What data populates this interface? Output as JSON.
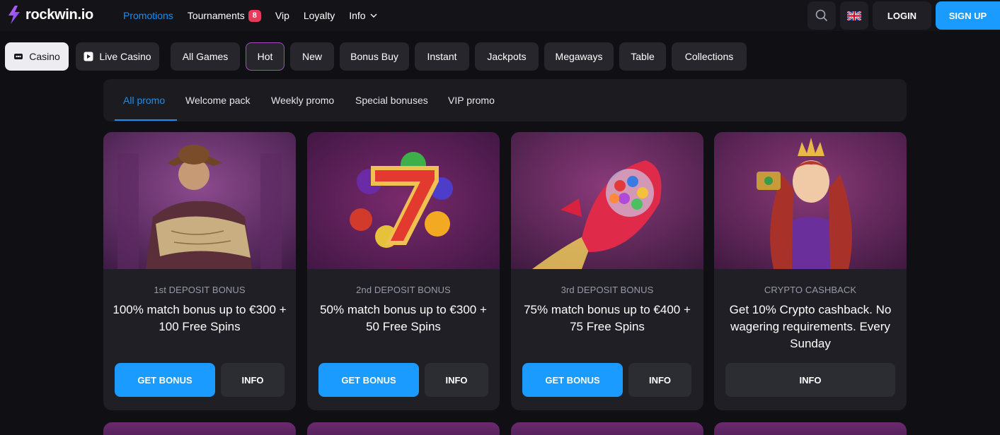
{
  "header": {
    "logo_text": "rockwin.io",
    "nav": [
      {
        "label": "Promotions",
        "active": true
      },
      {
        "label": "Tournaments",
        "badge": "8"
      },
      {
        "label": "Vip"
      },
      {
        "label": "Loyalty"
      },
      {
        "label": "Info",
        "has_dropdown": true
      }
    ],
    "search_icon": "search-icon",
    "language_icon": "uk-flag-icon",
    "login_label": "LOGIN",
    "signup_label": "SIGN UP"
  },
  "categories": [
    {
      "label": "Casino",
      "icon": "casino-icon",
      "selected": true
    },
    {
      "label": "Live Casino",
      "icon": "play-icon"
    },
    {
      "label": "All Games"
    },
    {
      "label": "Hot",
      "highlighted": true
    },
    {
      "label": "New"
    },
    {
      "label": "Bonus Buy"
    },
    {
      "label": "Instant"
    },
    {
      "label": "Jackpots"
    },
    {
      "label": "Megaways"
    },
    {
      "label": "Table"
    },
    {
      "label": "Collections"
    }
  ],
  "promo_tabs": [
    {
      "label": "All promo",
      "active": true
    },
    {
      "label": "Welcome pack"
    },
    {
      "label": "Weekly promo"
    },
    {
      "label": "Special bonuses"
    },
    {
      "label": "VIP promo"
    }
  ],
  "cards": [
    {
      "eyebrow": "1st DEPOSIT BONUS",
      "title": "100% match bonus up to €300 + 100 Free Spins",
      "get_label": "GET BONUS",
      "info_label": "INFO",
      "art": "explorer-illustration"
    },
    {
      "eyebrow": "2nd DEPOSIT BONUS",
      "title": "50% match bonus up to €300 + 50 Free Spins",
      "get_label": "GET BONUS",
      "info_label": "INFO",
      "art": "lucky-seven-illustration"
    },
    {
      "eyebrow": "3rd DEPOSIT BONUS",
      "title": "75% match bonus up to €400 + 75 Free Spins",
      "get_label": "GET BONUS",
      "info_label": "INFO",
      "art": "candy-rocket-illustration"
    },
    {
      "eyebrow": "CRYPTO CASHBACK",
      "title": "Get 10% Crypto cashback. No wagering requirements. Every Sunday",
      "info_label": "INFO",
      "art": "queen-illustration"
    }
  ],
  "colors": {
    "accent": "#1a9bff",
    "active_text": "#1b8ff2",
    "badge": "#ea3a5b",
    "background": "#101014",
    "card": "#1f1f25"
  }
}
